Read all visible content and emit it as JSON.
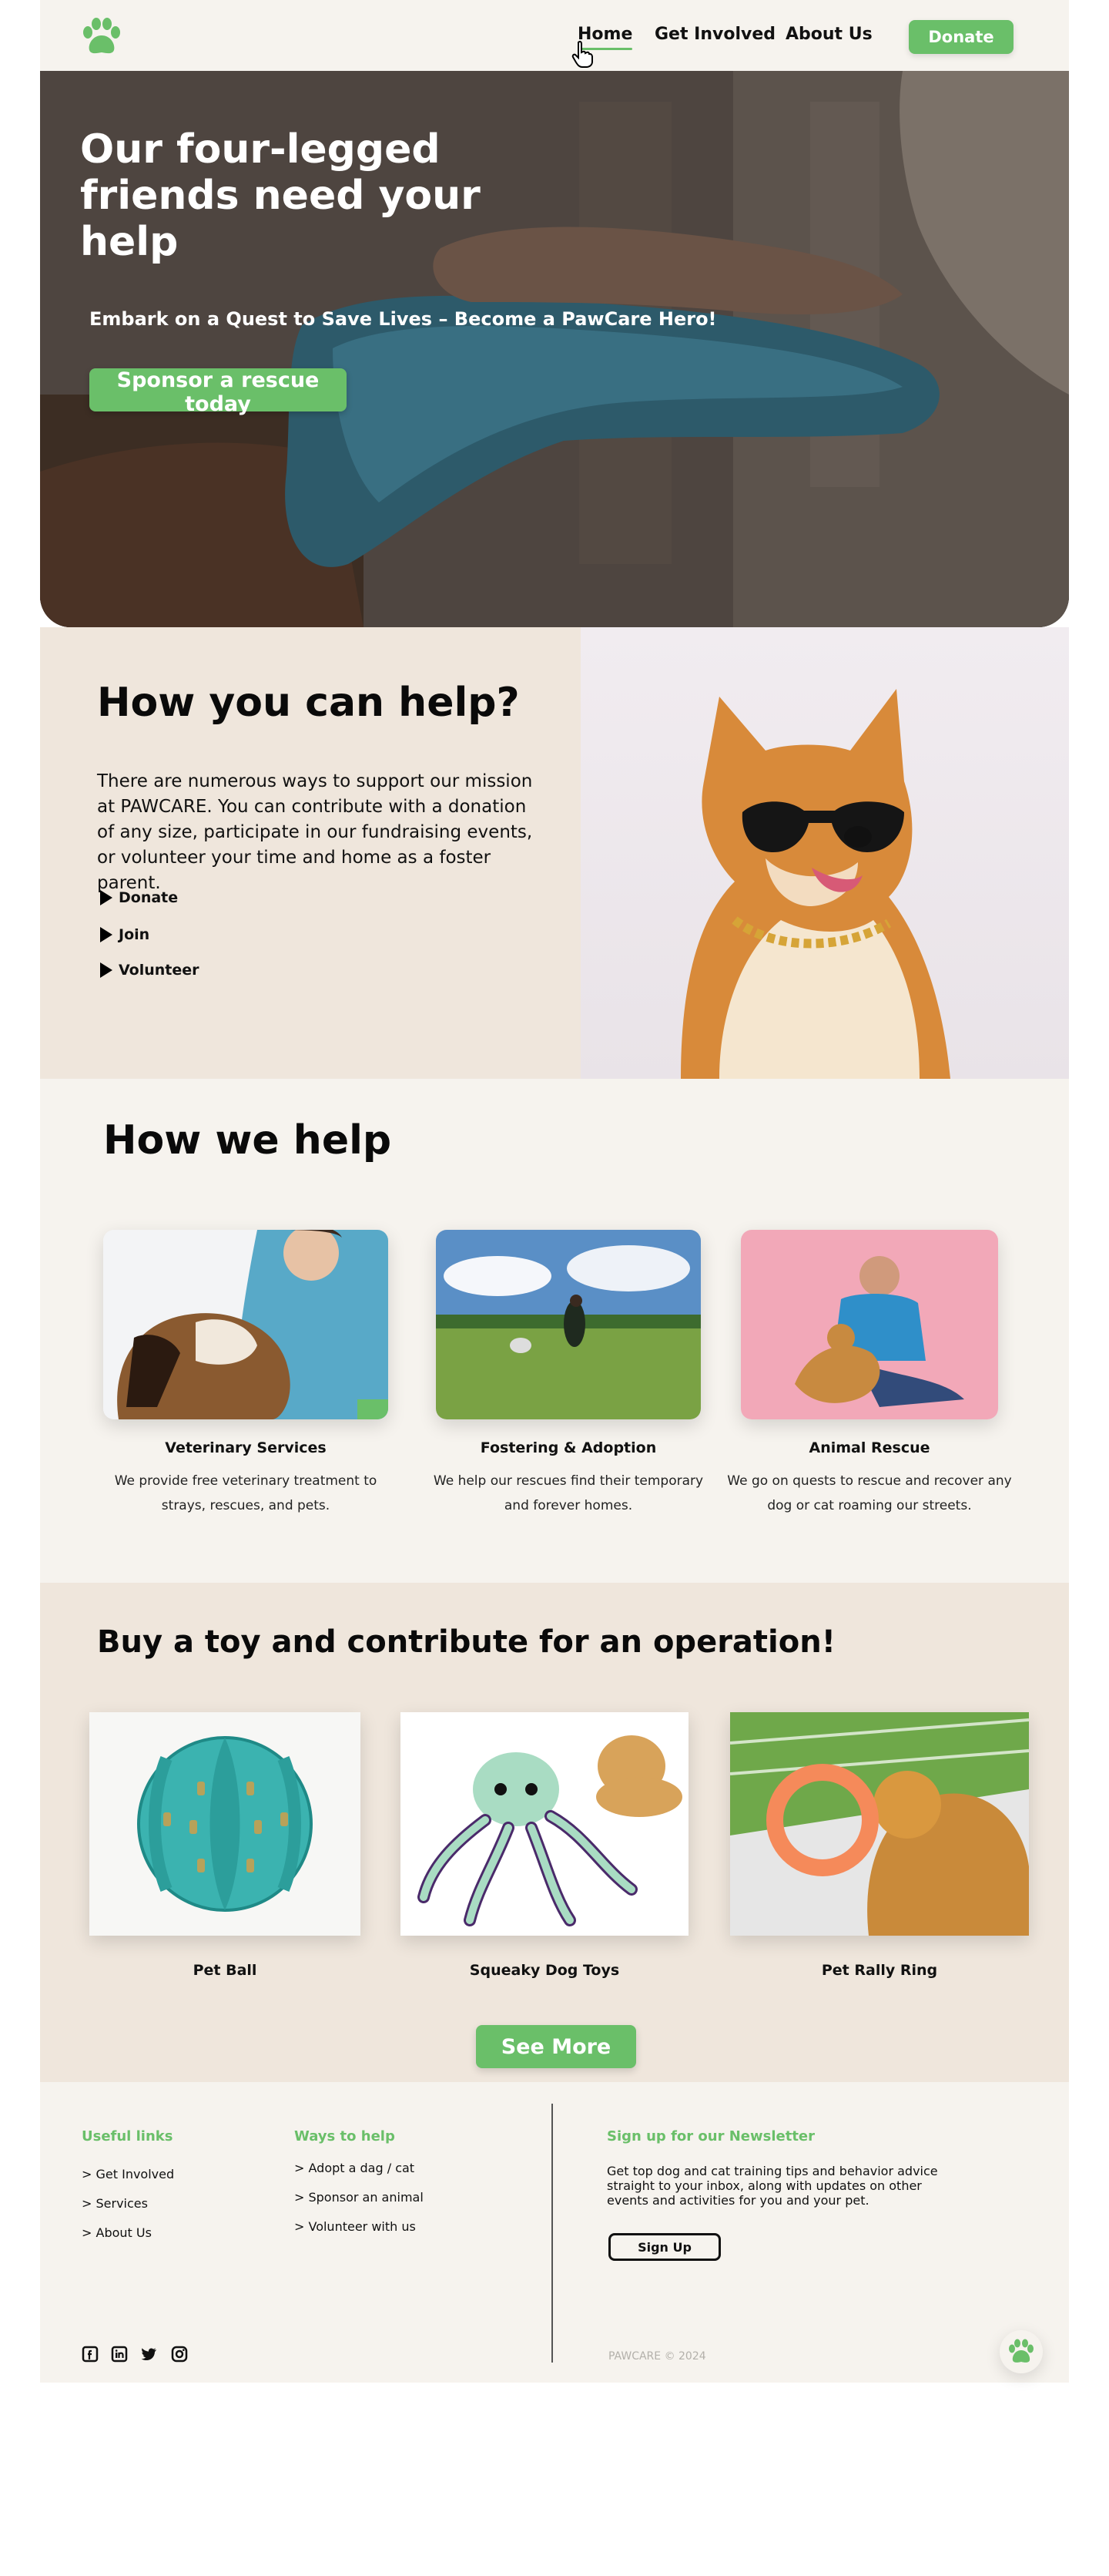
{
  "nav": {
    "items": [
      {
        "label": "Home"
      },
      {
        "label": "Get Involved"
      },
      {
        "label": "About Us"
      }
    ],
    "donate_label": "Donate",
    "active": "Home"
  },
  "hero": {
    "title": "Our four-legged friends need your help",
    "subtitle": "Embark on a Quest to Save Lives – Become a PawCare Hero!",
    "cta_label": "Sponsor a rescue today"
  },
  "help": {
    "title": "How you can help?",
    "text": "There are numerous ways to support our mission at PAWCARE. You can contribute with a donation of any size, participate in our fundraising events, or volunteer your time and home as a foster parent.",
    "items": [
      {
        "label": "Donate"
      },
      {
        "label": "Join"
      },
      {
        "label": "Volunteer"
      }
    ]
  },
  "we_help": {
    "title": "How we help",
    "services": [
      {
        "name": "Veterinary Services",
        "description": "We provide free veterinary treatment to strays, rescues, and pets."
      },
      {
        "name": "Fostering & Adoption",
        "description": "We help our rescues find their temporary and forever homes."
      },
      {
        "name": "Animal Rescue",
        "description": "We go on quests to rescue and recover any dog or cat roaming our streets."
      }
    ]
  },
  "toys": {
    "title": "Buy a toy and contribute for an operation!",
    "products": [
      {
        "name": "Pet Ball"
      },
      {
        "name": "Squeaky Dog Toys"
      },
      {
        "name": "Pet Rally Ring"
      }
    ],
    "more_label": "See More"
  },
  "footer": {
    "useful_links": {
      "title": "Useful links",
      "links": [
        "> Get Involved",
        "> Services",
        "> About Us"
      ]
    },
    "ways_to_help": {
      "title": "Ways to help",
      "links": [
        "> Adopt a dag / cat",
        "> Sponsor an animal",
        "> Volunteer with us"
      ]
    },
    "newsletter": {
      "title": "Sign up for our Newsletter",
      "text": "Get top dog and cat training tips and behavior advice straight to your inbox, along with updates on other events and activities for you and your pet.",
      "button_label": "Sign Up"
    },
    "copyright": "PAWCARE © 2024",
    "social_icons": [
      "facebook-icon",
      "linkedin-icon",
      "twitter-icon",
      "instagram-icon"
    ]
  },
  "colors": {
    "accent": "#6abf69",
    "cream": "#f6f3ee",
    "sand": "#efe6dc"
  }
}
